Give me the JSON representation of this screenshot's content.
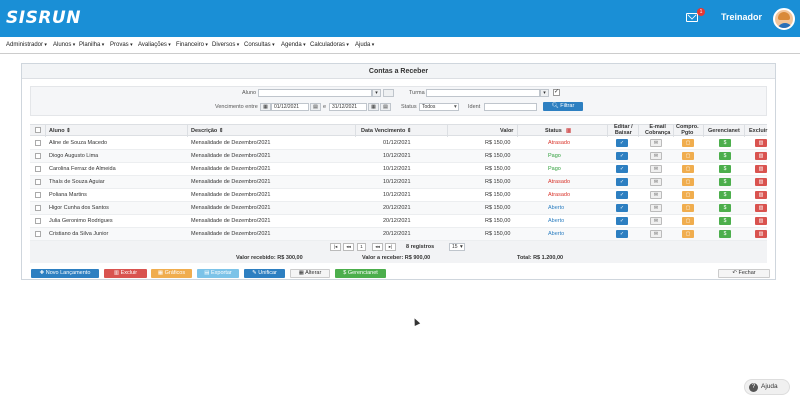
{
  "header": {
    "logo": "SISRUN",
    "mail_count": "1",
    "user": "Treinador"
  },
  "menu": [
    "Administrador",
    "Alunos",
    "Planilha",
    "Provas",
    "Avaliações",
    "Financeiro",
    "Diversos",
    "Consultas",
    "Agenda",
    "Calculadoras",
    "Ajuda"
  ],
  "panel": {
    "title": "Contas a Receber"
  },
  "filters": {
    "aluno_label": "Aluno",
    "turma_label": "Turma",
    "vencimento_label": "Vencimento entre",
    "date_from": "01/12/2021",
    "e_label": "e",
    "date_to": "31/12/2021",
    "status_label": "Status",
    "status_value": "Todos",
    "ident_label": "Ident",
    "filter_button": "Filtrar"
  },
  "table": {
    "headers": {
      "aluno": "Aluno",
      "descricao": "Descrição",
      "vencimento": "Data Vencimento",
      "valor": "Valor",
      "status": "Status",
      "editar1": "Editar /",
      "editar2": "Baixar",
      "email1": "E-mail",
      "email2": "Cobrança",
      "compro1": "Compro.",
      "compro2": "Pgto",
      "gerencianet": "Gerencianet",
      "excluir": "Excluir"
    },
    "rows": [
      {
        "aluno": "Aline de Souza Macedo",
        "descricao": "Mensalidade de Dezembro/2021",
        "vencimento": "01/12/2021",
        "valor": "R$ 150,00",
        "status": "Atrasado"
      },
      {
        "aluno": "Diogo Augusto Lima",
        "descricao": "Mensalidade de Dezembro/2021",
        "vencimento": "10/12/2021",
        "valor": "R$ 150,00",
        "status": "Pago"
      },
      {
        "aluno": "Carolina Ferraz de Almeida",
        "descricao": "Mensalidade de Dezembro/2021",
        "vencimento": "10/12/2021",
        "valor": "R$ 150,00",
        "status": "Pago"
      },
      {
        "aluno": "Thaís de Souza Aguiar",
        "descricao": "Mensalidade de Dezembro/2021",
        "vencimento": "10/12/2021",
        "valor": "R$ 150,00",
        "status": "Atrasado"
      },
      {
        "aluno": "Poliana Martins",
        "descricao": "Mensalidade de Dezembro/2021",
        "vencimento": "10/12/2021",
        "valor": "R$ 150,00",
        "status": "Atrasado"
      },
      {
        "aluno": "Higor Cunha dos Santos",
        "descricao": "Mensalidade de Dezembro/2021",
        "vencimento": "20/12/2021",
        "valor": "R$ 150,00",
        "status": "Aberto"
      },
      {
        "aluno": "Julia Geronimo Rodrigues",
        "descricao": "Mensalidade de Dezembro/2021",
        "vencimento": "20/12/2021",
        "valor": "R$ 150,00",
        "status": "Aberto"
      },
      {
        "aluno": "Cristiano da Silva Junior",
        "descricao": "Mensalidade de Dezembro/2021",
        "vencimento": "20/12/2021",
        "valor": "R$ 150,00",
        "status": "Aberto"
      }
    ],
    "status_colors": {
      "Atrasado": "#d9342b",
      "Pago": "#2e9e3a",
      "Aberto": "#2d7fc1"
    }
  },
  "pager": {
    "page": "1",
    "records": "8 registros",
    "per_page": "15"
  },
  "totals": {
    "recebido": "Valor recebido: R$ 300,00",
    "a_receber": "Valor a receber: R$ 900,00",
    "total": "Total: R$ 1.200,00"
  },
  "actions": {
    "novo": "Novo Lançamento",
    "excluir": "Excluir",
    "graficos": "Gráficos",
    "exportar": "Exportar",
    "unificar": "Unificar",
    "alterar": "Alterar",
    "gerencianet": "Gerencianet",
    "fechar": "Fechar"
  },
  "help": "Ajuda"
}
